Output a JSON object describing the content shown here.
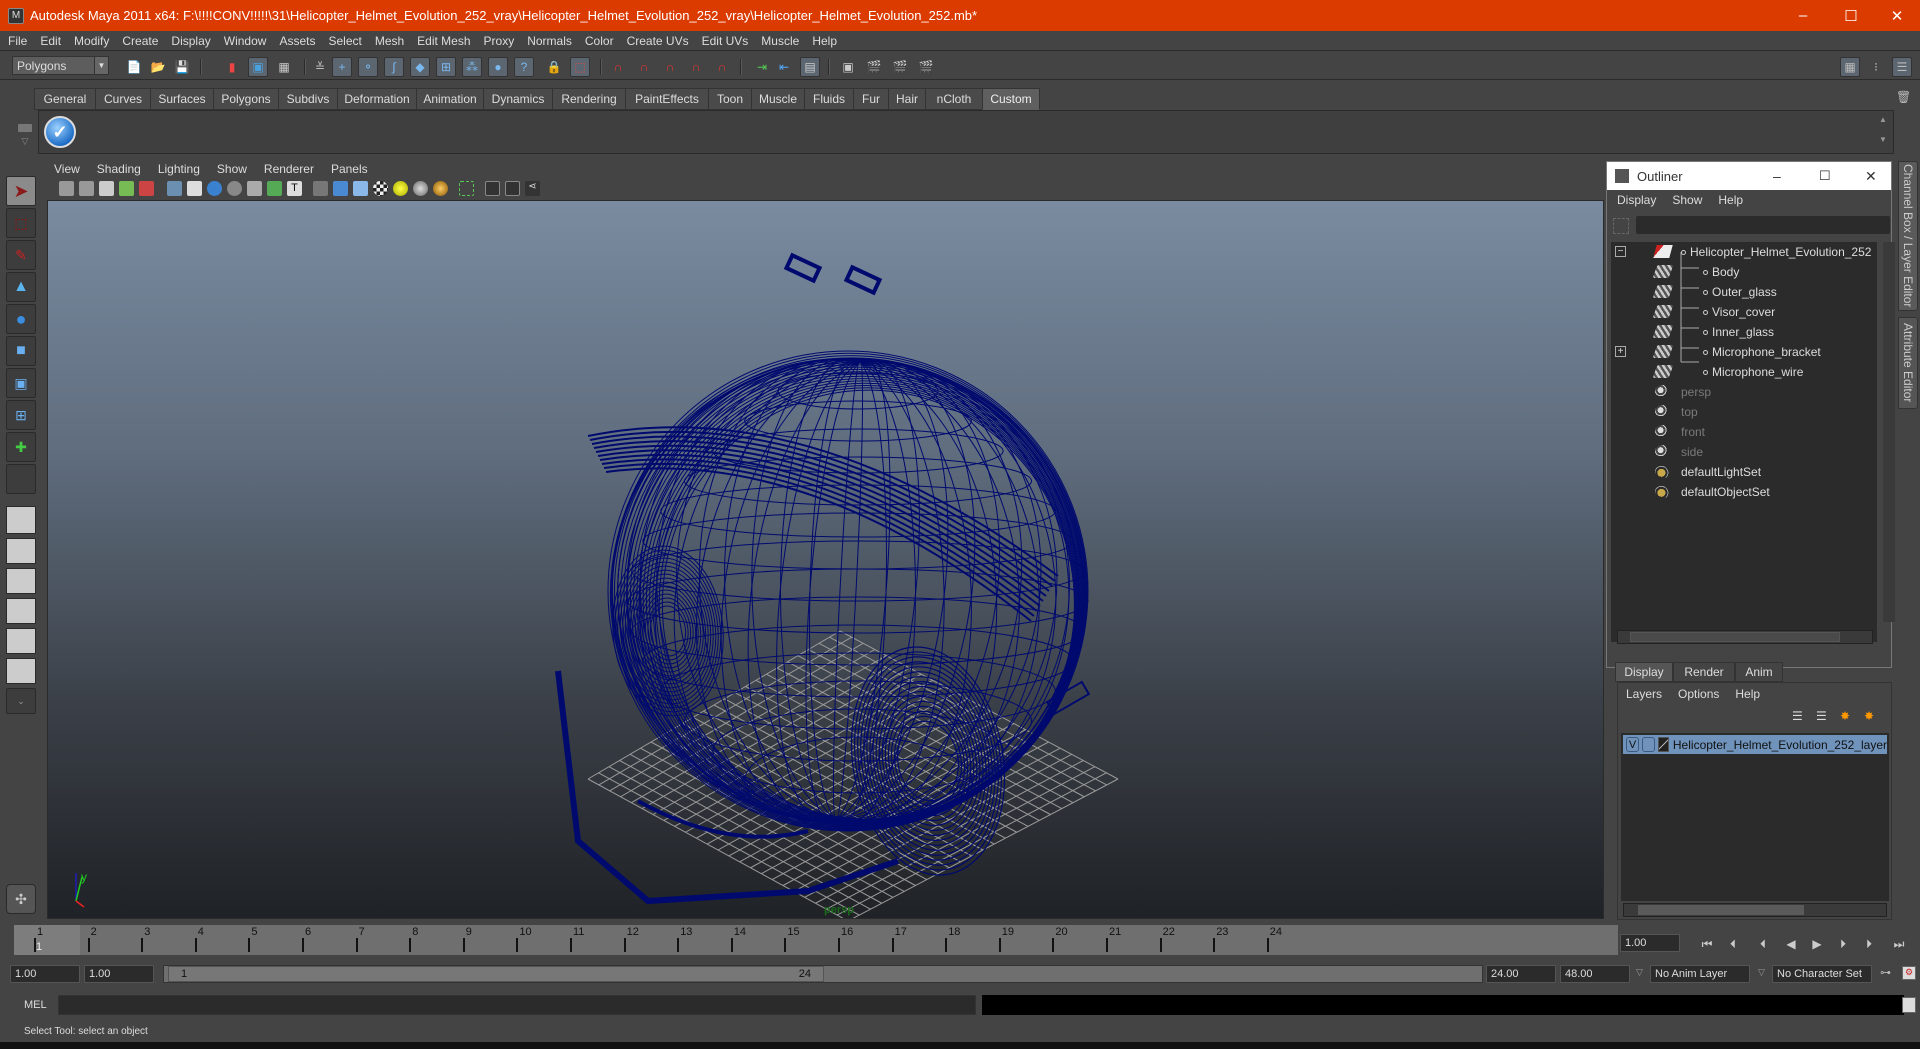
{
  "window": {
    "title": "Autodesk Maya 2011 x64: F:\\!!!!CONV!!!!!\\31\\Helicopter_Helmet_Evolution_252_vray\\Helicopter_Helmet_Evolution_252_vray\\Helicopter_Helmet_Evolution_252.mb*",
    "minimize": "–",
    "maximize": "☐",
    "close": "✕"
  },
  "menubar": [
    "File",
    "Edit",
    "Modify",
    "Create",
    "Display",
    "Window",
    "Assets",
    "Select",
    "Mesh",
    "Edit Mesh",
    "Proxy",
    "Normals",
    "Color",
    "Create UVs",
    "Edit UVs",
    "Muscle",
    "Help"
  ],
  "statusline": {
    "mode": "Polygons"
  },
  "shelf": {
    "tabs": [
      "General",
      "Curves",
      "Surfaces",
      "Polygons",
      "Subdivs",
      "Deformation",
      "Animation",
      "Dynamics",
      "Rendering",
      "PaintEffects",
      "Toon",
      "Muscle",
      "Fluids",
      "Fur",
      "Hair",
      "nCloth",
      "Custom"
    ],
    "active_tab": "Custom",
    "items": [
      {
        "icon": "checkmark-icon"
      }
    ]
  },
  "viewport": {
    "menus": [
      "View",
      "Shading",
      "Lighting",
      "Show",
      "Renderer",
      "Panels"
    ],
    "camera_label": "persp",
    "axis_labels": {
      "y": "y",
      "z": "z"
    },
    "wireframe_color": "#000a6e"
  },
  "outliner": {
    "title": "Outliner",
    "menus": [
      "Display",
      "Show",
      "Help"
    ],
    "items": [
      {
        "label": "Helicopter_Helmet_Evolution_252",
        "type": "group",
        "expanded": true,
        "level": 0
      },
      {
        "label": "Body",
        "type": "mesh",
        "level": 1
      },
      {
        "label": "Outer_glass",
        "type": "mesh",
        "level": 1
      },
      {
        "label": "Visor_cover",
        "type": "mesh",
        "level": 1
      },
      {
        "label": "Inner_glass",
        "type": "mesh",
        "level": 1
      },
      {
        "label": "Microphone_bracket",
        "type": "mesh",
        "level": 1,
        "expandable": true
      },
      {
        "label": "Microphone_wire",
        "type": "mesh",
        "level": 1
      },
      {
        "label": "persp",
        "type": "camera",
        "level": 0,
        "dim": true
      },
      {
        "label": "top",
        "type": "camera",
        "level": 0,
        "dim": true
      },
      {
        "label": "front",
        "type": "camera",
        "level": 0,
        "dim": true
      },
      {
        "label": "side",
        "type": "camera",
        "level": 0,
        "dim": true
      },
      {
        "label": "defaultLightSet",
        "type": "set",
        "level": 0
      },
      {
        "label": "defaultObjectSet",
        "type": "set",
        "level": 0
      }
    ]
  },
  "side_tabs": [
    "Channel Box / Layer Editor",
    "Attribute Editor"
  ],
  "layer_editor": {
    "tabs": [
      "Display",
      "Render",
      "Anim"
    ],
    "active_tab": "Display",
    "menus": [
      "Layers",
      "Options",
      "Help"
    ],
    "layers": [
      {
        "visible": "V",
        "name": "Helicopter_Helmet_Evolution_252_layer"
      }
    ]
  },
  "timeline": {
    "ticks": [
      "1",
      "2",
      "3",
      "4",
      "5",
      "6",
      "7",
      "8",
      "9",
      "10",
      "11",
      "12",
      "13",
      "14",
      "15",
      "16",
      "17",
      "18",
      "19",
      "20",
      "21",
      "22",
      "23",
      "24"
    ],
    "current_frame": "1",
    "current_time_field": "1.00",
    "start_time": "1.00",
    "playback_start": "1.00",
    "range_start_label": "1",
    "range_end_label": "24",
    "playback_end": "24.00",
    "end_time": "48.00",
    "anim_layer": "No Anim Layer",
    "character_set": "No Character Set",
    "playback_buttons": [
      "go-to-start",
      "step-back-key",
      "step-back-frame",
      "play-backward",
      "play-forward",
      "step-forward-frame",
      "step-forward-key",
      "go-to-end"
    ]
  },
  "command_line": {
    "label": "MEL",
    "value": ""
  },
  "status": {
    "help_line": "Select Tool: select an object"
  }
}
